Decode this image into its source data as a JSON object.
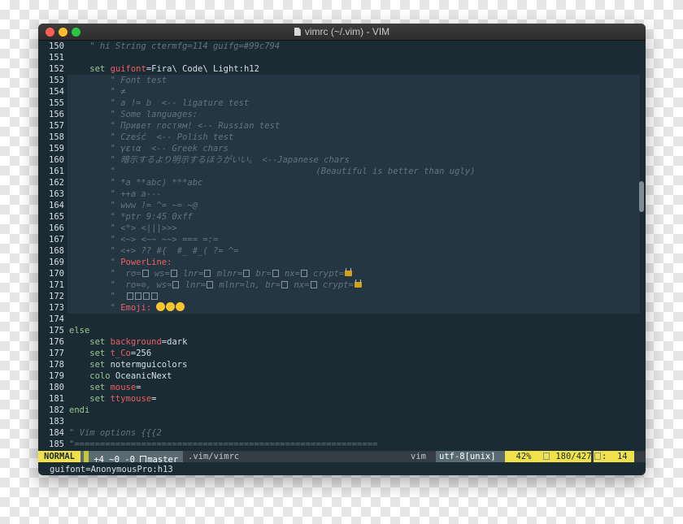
{
  "window": {
    "title": "vimrc (~/.vim) - VIM",
    "colors": {
      "background": "#1b2b34",
      "comment": "#65737e",
      "keyword": "#99c794",
      "option": "#ec5f67",
      "text": "#d8dee9",
      "accent": "#f0e14a"
    }
  },
  "lines": [
    {
      "num": "150",
      "segs": [
        {
          "t": "    \" hi String ctermfg=114 guifg=#99c794",
          "c": "cm"
        }
      ]
    },
    {
      "num": "151",
      "segs": []
    },
    {
      "num": "152",
      "segs": [
        {
          "t": "    set ",
          "c": "kw"
        },
        {
          "t": "guifont",
          "c": "pl"
        },
        {
          "t": "=Fira\\ Code\\ Light:h12",
          "c": "op"
        }
      ]
    },
    {
      "num": "153",
      "segs": [
        {
          "t": "        \" Font test",
          "c": "cm"
        }
      ]
    },
    {
      "num": "154",
      "segs": [
        {
          "t": "        \" ≠",
          "c": "cm"
        }
      ]
    },
    {
      "num": "155",
      "segs": [
        {
          "t": "        \" a != b  <-- ligature test",
          "c": "cm"
        }
      ]
    },
    {
      "num": "156",
      "segs": [
        {
          "t": "        \" Some languages:",
          "c": "cm"
        }
      ]
    },
    {
      "num": "157",
      "segs": [
        {
          "t": "        \" Привет гостям! <-- Russian test",
          "c": "cm"
        }
      ]
    },
    {
      "num": "158",
      "segs": [
        {
          "t": "        \" Cześć  <-- Polish test",
          "c": "cm"
        }
      ]
    },
    {
      "num": "159",
      "segs": [
        {
          "t": "        \" γεια  <-- Greek chars",
          "c": "cm"
        }
      ]
    },
    {
      "num": "160",
      "segs": [
        {
          "t": "        \" 暗示するより明示するほうがいい。 <--Japanese chars",
          "c": "cm"
        }
      ]
    },
    {
      "num": "161",
      "segs": [
        {
          "t": "        \"                                       (Beautiful is better than ugly)",
          "c": "cm"
        }
      ]
    },
    {
      "num": "162",
      "segs": [
        {
          "t": "        \" *a **abc) ***abc",
          "c": "cm"
        }
      ]
    },
    {
      "num": "163",
      "segs": [
        {
          "t": "        \" ++a a---",
          "c": "cm"
        }
      ]
    },
    {
      "num": "164",
      "segs": [
        {
          "t": "        \" www != ^= ~= ~@",
          "c": "cm"
        }
      ]
    },
    {
      "num": "165",
      "segs": [
        {
          "t": "        \" *ptr 9:45 0xff",
          "c": "cm"
        }
      ]
    },
    {
      "num": "166",
      "segs": [
        {
          "t": "        \" <*> <|||>>>",
          "c": "cm"
        }
      ]
    },
    {
      "num": "167",
      "segs": [
        {
          "t": "        \" <~> <~~ ~~> === =:=",
          "c": "cm"
        }
      ]
    },
    {
      "num": "168",
      "segs": [
        {
          "t": "        \" <+> ?? #{  #_ #_( ?= ^=",
          "c": "cm"
        }
      ]
    },
    {
      "num": "169",
      "segs": [
        {
          "t": "        \" ",
          "c": "cm"
        },
        {
          "t": "PowerLine:",
          "c": "pl"
        }
      ]
    },
    {
      "num": "170",
      "segs": [
        {
          "t": "        \"  ro=",
          "c": "cm"
        },
        {
          "box": true
        },
        {
          "t": " ws=",
          "c": "cm"
        },
        {
          "box": true
        },
        {
          "t": " lnr=",
          "c": "cm"
        },
        {
          "box": true
        },
        {
          "t": " mlnr=",
          "c": "cm"
        },
        {
          "box": true
        },
        {
          "t": " br=",
          "c": "cm"
        },
        {
          "box": true
        },
        {
          "t": " nx=",
          "c": "cm"
        },
        {
          "box": true
        },
        {
          "t": " crypt=",
          "c": "cm"
        },
        {
          "lock": true
        }
      ]
    },
    {
      "num": "171",
      "segs": [
        {
          "t": "        \"  ro=⊘, ws=",
          "c": "cm"
        },
        {
          "box": true
        },
        {
          "t": " lnr=",
          "c": "cm"
        },
        {
          "box": true
        },
        {
          "t": " mlnr=ln, br=",
          "c": "cm"
        },
        {
          "box": true
        },
        {
          "t": " nx=",
          "c": "cm"
        },
        {
          "box": true
        },
        {
          "t": " crypt=",
          "c": "cm"
        },
        {
          "lock": true
        }
      ]
    },
    {
      "num": "172",
      "segs": [
        {
          "t": "        \"  ",
          "c": "cm"
        },
        {
          "box": true
        },
        {
          "box": true
        },
        {
          "box": true
        },
        {
          "box": true
        }
      ]
    },
    {
      "num": "173",
      "segs": [
        {
          "t": "        \" ",
          "c": "cm"
        },
        {
          "t": "Emoji: ",
          "c": "pl"
        },
        {
          "emoji": 3
        }
      ]
    },
    {
      "num": "174",
      "segs": []
    },
    {
      "num": "175",
      "segs": [
        {
          "t": "else",
          "c": "kw"
        }
      ]
    },
    {
      "num": "176",
      "segs": [
        {
          "t": "    set ",
          "c": "kw"
        },
        {
          "t": "background",
          "c": "pl"
        },
        {
          "t": "=dark",
          "c": "op"
        }
      ]
    },
    {
      "num": "177",
      "segs": [
        {
          "t": "    set ",
          "c": "kw"
        },
        {
          "t": "t_Co",
          "c": "pl"
        },
        {
          "t": "=256",
          "c": "op"
        }
      ]
    },
    {
      "num": "178",
      "segs": [
        {
          "t": "    set ",
          "c": "kw"
        },
        {
          "t": "notermguicolors",
          "c": "op"
        }
      ]
    },
    {
      "num": "179",
      "segs": [
        {
          "t": "    colo ",
          "c": "kw"
        },
        {
          "t": "OceanicNext",
          "c": "op"
        }
      ]
    },
    {
      "num": "180",
      "segs": [
        {
          "t": "    set ",
          "c": "kw"
        },
        {
          "t": "mouse",
          "c": "pl"
        },
        {
          "t": "=",
          "c": "op"
        }
      ]
    },
    {
      "num": "181",
      "segs": [
        {
          "t": "    set ",
          "c": "kw"
        },
        {
          "t": "ttymouse",
          "c": "pl"
        },
        {
          "t": "=",
          "c": "op"
        }
      ]
    },
    {
      "num": "182",
      "segs": [
        {
          "t": "endi",
          "c": "kw"
        }
      ]
    },
    {
      "num": "183",
      "segs": []
    },
    {
      "num": "184",
      "segs": [
        {
          "t": "\" Vim options {{{2",
          "c": "cm"
        }
      ]
    },
    {
      "num": "185",
      "segs": [
        {
          "t": "\"===========================================================",
          "c": "cm"
        }
      ]
    }
  ],
  "statusline": {
    "mode": "NORMAL",
    "hunks": "+4 ~0 -0",
    "branch": "master",
    "file": ".vim/vimrc",
    "filetype": "vim",
    "encoding": "utf-8[unix]",
    "percent": "42%",
    "line_pos": "180/427",
    "col_pos": ":  14"
  },
  "cmdline": "guifont=AnonymousPro:h13"
}
